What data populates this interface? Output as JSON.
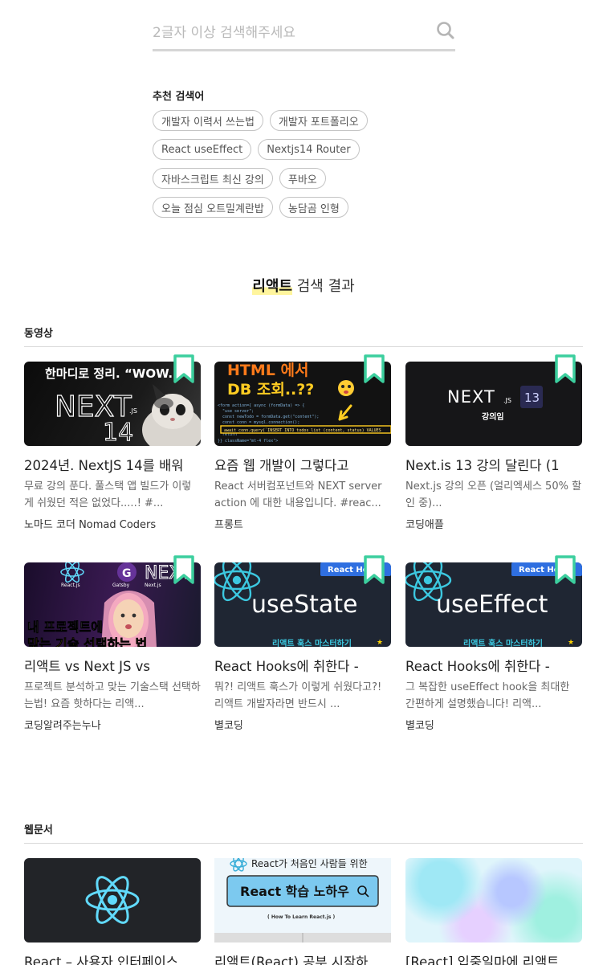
{
  "search": {
    "placeholder": "2글자 이상 검색해주세요",
    "value": ""
  },
  "recommended": {
    "title": "추천 검색어",
    "tags": [
      "개발자 이력서 쓰는법",
      "개발자 포트폴리오",
      "React useEffect",
      "Nextjs14 Router",
      "자바스크립트 최신 강의",
      "푸바오",
      "오늘 점심 오트밀계란밥",
      "농담곰 인형"
    ]
  },
  "results": {
    "keyword": "리액트",
    "suffix": " 검색 결과"
  },
  "videos": {
    "section_title": "동영상",
    "items": [
      {
        "title": "2024년. NextJS 14를 배워",
        "desc": "무료 강의 푼다. 풀스택 앱 빌드가 이렇게 쉬웠던 적은 없었다.....! #...",
        "channel": "노마드 코더 Nomad Coders",
        "thumb_top": "한마디로 정리. “WOW.”",
        "thumb_main": "NEXT",
        "thumb_num": "14",
        "thumb_sub": ".JS"
      },
      {
        "title": "요즘 웹 개발이 그렇다고",
        "desc": "React 서버컴포넌트와 NEXT server action 에 대한 내용입니다. #reac...",
        "channel": "프롱트",
        "thumb_top": "HTML 에서",
        "thumb_main": "DB 조회..??"
      },
      {
        "title": "Next.is 13 강의 달린다 (1",
        "desc": "Next.js 강의 오픈 (얼리엑세스 50% 할인 중)...",
        "channel": "코딩애플",
        "thumb_main": "NEXT",
        "thumb_sub": ".JS",
        "thumb_num": "13",
        "thumb_caption": "강의임"
      },
      {
        "title": "리액트 vs Next JS vs",
        "desc": "프로젝트 분석하고 맞는 기술스택 선택하는법! 요즘 핫하다는 리액...",
        "channel": "코딩알려주는누나",
        "thumb_top": "내 프로젝트에",
        "thumb_main": "맞는 기술 선택하는 법",
        "thumb_labels": [
          "React.js",
          "Gatsby",
          "Next.js"
        ]
      },
      {
        "title": "React Hooks에 취한다 -",
        "desc": "뭐?! 리액트 훅스가 이렇게 쉬웠다고?! 리액트 개발자라면 반드시 ...",
        "channel": "별코딩",
        "thumb_badge": "React Hooks",
        "thumb_main": "useState",
        "thumb_caption": "리액트 훅스 마스터하기"
      },
      {
        "title": "React Hooks에 취한다 -",
        "desc": "그 복잡한 useEffect hook을 최대한 간편하게 설명했습니다! 리액...",
        "channel": "별코딩",
        "thumb_badge": "React Hooks",
        "thumb_main": "useEffect",
        "thumb_caption": "리액트 훅스 마스터하기"
      }
    ]
  },
  "docs": {
    "section_title": "웹문서",
    "items": [
      {
        "title": "React – 사용자 인터페이스"
      },
      {
        "title": "리액트(React) 공부 시작하",
        "thumb_top": "React가 처음인 사람들 위한",
        "thumb_main": "React 학습 노하우",
        "thumb_sub": "( How To Learn React.js )"
      },
      {
        "title": "[React] 입중일마에 리액트"
      }
    ]
  },
  "colors": {
    "bookmark": "#3ccf9e",
    "highlight": "#fff59d",
    "react_blue": "#61dafb",
    "hooks_badge": "#2f6fe0"
  }
}
